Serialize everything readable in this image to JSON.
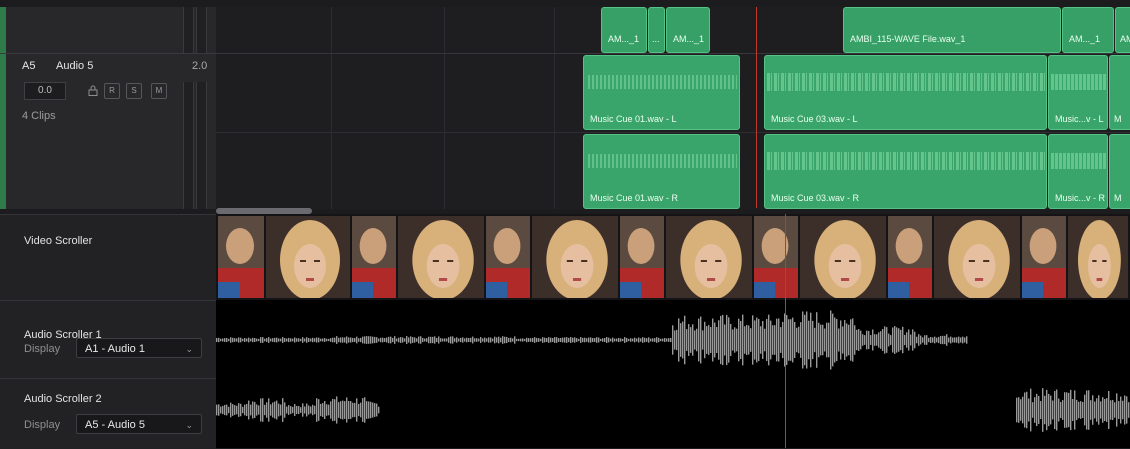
{
  "top_lane": {
    "clips": [
      "AM..._1",
      "...",
      "AM..._1",
      "AMBI_115-WAVE File.wav_1",
      "AM..._1",
      "AM"
    ]
  },
  "track_a5": {
    "id": "A5",
    "name": "Audio 5",
    "channels": "2.0",
    "volume": "0.0",
    "buttons": [
      "R",
      "S",
      "M"
    ],
    "clip_count": "4 Clips",
    "clips_left": [
      "Music Cue 01.wav - L",
      "Music Cue 03.wav - L",
      "Music...v - L",
      "M"
    ],
    "clips_right": [
      "Music Cue 01.wav - R",
      "Music Cue 03.wav - R",
      "Music...v - R",
      "M"
    ]
  },
  "video_scroller": {
    "title": "Video Scroller"
  },
  "audio_scroller_1": {
    "title": "Audio Scroller 1",
    "display_label": "Display",
    "display_value": "A1 - Audio 1"
  },
  "audio_scroller_2": {
    "title": "Audio Scroller 2",
    "display_label": "Display",
    "display_value": "A5 - Audio 5"
  },
  "colors": {
    "clip_green": "#3aa56a",
    "playhead": "#c0392b",
    "waveform": "#9a9a9a"
  },
  "icons": [
    "lock-icon",
    "chevron-down-icon"
  ]
}
